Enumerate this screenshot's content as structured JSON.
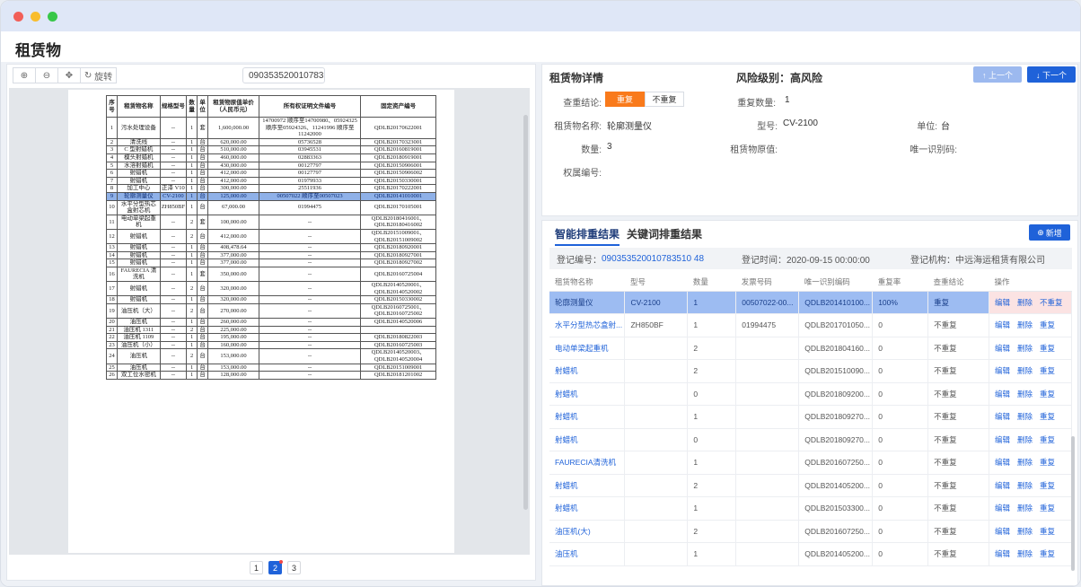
{
  "page": {
    "title": "租赁物"
  },
  "viewer": {
    "toolbar": {
      "zoom_in": "⊕",
      "zoom_out": "⊖",
      "move": "✥",
      "rotate": "旋转"
    },
    "doc_select": "090353520010783",
    "headers": [
      "序号",
      "租赁物名称",
      "规格型号",
      "数量",
      "单位",
      "租赁物原值单价（人民币元）",
      "所有权证明文件编号",
      "固定资产编号"
    ],
    "rows": [
      [
        "1",
        "污水处理设备",
        "--",
        "1",
        "套",
        "1,600,000.00",
        "14700972 顺序至14700980、05924325 顺序至05924326、11241996 顺序至11242000",
        "QDLB20170622001"
      ],
      [
        "2",
        "清洗线",
        "--",
        "1",
        "台",
        "620,000.00",
        "05736528",
        "QDLB20170323001"
      ],
      [
        "3",
        "C 型射蜡机",
        "--",
        "1",
        "台",
        "510,000.00",
        "03945531",
        "QDLB20160819001"
      ],
      [
        "4",
        "模头射蜡机",
        "--",
        "1",
        "台",
        "460,000.00",
        "02883363",
        "QDLB20180919001"
      ],
      [
        "5",
        "水溶射蜡机",
        "--",
        "1",
        "台",
        "430,000.00",
        "00127797",
        "QDLB20150906001"
      ],
      [
        "6",
        "射蜡机",
        "--",
        "1",
        "台",
        "412,000.00",
        "00127797",
        "QDLB20150906002"
      ],
      [
        "7",
        "射蜡机",
        "--",
        "1",
        "台",
        "412,000.00",
        "01979933",
        "QDLB20150330001"
      ],
      [
        "8",
        "加工中心",
        "正泽 V10",
        "1",
        "台",
        "300,000.00",
        "25511936",
        "QDLB20170222001"
      ],
      [
        "9",
        "轮廓测量仪",
        "CV-2100",
        "1",
        "台",
        "125,000.00",
        "00507022 顺序至00507023",
        "QDLB20141010001"
      ],
      [
        "10",
        "水平分型热芯盒射芯机",
        "ZH850BF",
        "1",
        "台",
        "67,000.00",
        "01994475",
        "QDLB20170105001"
      ],
      [
        "11",
        "电动单梁起重机",
        "--",
        "2",
        "套",
        "100,000.00",
        "--",
        "QDLB20180416001、QDLB20180416002"
      ],
      [
        "12",
        "射蜡机",
        "--",
        "2",
        "台",
        "412,000.00",
        "--",
        "QDLB20151009001、QDLB20151009002"
      ],
      [
        "13",
        "射蜡机",
        "--",
        "1",
        "台",
        "408,478.64",
        "--",
        "QDLB20180920001"
      ],
      [
        "14",
        "射蜡机",
        "--",
        "1",
        "台",
        "377,000.00",
        "--",
        "QDLB20180927001"
      ],
      [
        "15",
        "射蜡机",
        "--",
        "1",
        "台",
        "377,000.00",
        "--",
        "QDLB20180927002"
      ],
      [
        "16",
        "FAURECIA 清洗机",
        "--",
        "1",
        "套",
        "350,000.00",
        "--",
        "QDLB20160725004"
      ],
      [
        "17",
        "射蜡机",
        "--",
        "2",
        "台",
        "320,000.00",
        "--",
        "QDLB20140520001、QDLB20140520002"
      ],
      [
        "18",
        "射蜡机",
        "--",
        "1",
        "台",
        "320,000.00",
        "--",
        "QDLB20150330002"
      ],
      [
        "19",
        "油压机（大）",
        "--",
        "2",
        "台",
        "270,000.00",
        "--",
        "QDLB20160725001、QDLB20160725002"
      ],
      [
        "20",
        "油压机",
        "--",
        "1",
        "台",
        "260,000.00",
        "--",
        "QDLB20140520006"
      ],
      [
        "21",
        "油压机 1311",
        "--",
        "2",
        "台",
        "225,000.00",
        "--",
        ""
      ],
      [
        "22",
        "油压机 1109",
        "--",
        "1",
        "台",
        "195,000.00",
        "--",
        "QDLB20180822003"
      ],
      [
        "23",
        "油压机（小）",
        "--",
        "1",
        "台",
        "160,000.00",
        "--",
        "QDLB20160725003"
      ],
      [
        "24",
        "油压机",
        "--",
        "2",
        "台",
        "153,000.00",
        "--",
        "QDLB20140520003、QDLB20140520004"
      ],
      [
        "25",
        "油压机",
        "--",
        "1",
        "台",
        "153,000.00",
        "--",
        "QDLB20151009001"
      ],
      [
        "26",
        "双工位水密机",
        "--",
        "1",
        "台",
        "128,000.00",
        "--",
        "QDLB20181201002"
      ]
    ],
    "selected_row": 8,
    "pages": [
      "1",
      "2",
      "3"
    ],
    "active_page": 1
  },
  "detail": {
    "title": "租赁物详情",
    "risk": "风险级别：高风险",
    "prev": "↑ 上一个",
    "next": "↓ 下一个",
    "check_label": "查重结论:",
    "check_on": "重复",
    "check_off": "不重复",
    "dup_count_label": "重复数量:",
    "dup_count": "1",
    "name_label": "租赁物名称:",
    "name": "轮廓测量仪",
    "model_label": "型号:",
    "model": "CV-2100",
    "unit_label": "单位:",
    "unit": "台",
    "qty_label": "数量:",
    "qty": "3",
    "orig_label": "租赁物原值:",
    "uid_label": "唯一识别码:",
    "right_label": "权属编号:"
  },
  "results": {
    "tab_smart": "智能排重结果",
    "tab_keyword": "关键词排重结果",
    "new_btn": "新增",
    "reg_no_label": "登记编号：",
    "reg_no": "090353520010783510 48",
    "reg_time": "登记时间：2020-09-15 00:00:00",
    "reg_org": "登记机构：中远海运租赁有限公司",
    "headers": [
      "租赁物名称",
      "型号",
      "数量",
      "发票号码",
      "唯一识别编码",
      "重复率",
      "查重结论",
      "操作"
    ],
    "rows": [
      [
        "轮廓测量仪",
        "CV-2100",
        "1",
        "00507022-00...",
        "QDLB201410100...",
        "100%",
        "重复",
        "不重复"
      ],
      [
        "水平分型热芯盒射...",
        "ZH850BF",
        "1",
        "01994475",
        "QDLB201701050...",
        "0",
        "不重复",
        "重复"
      ],
      [
        "电动单梁起重机",
        "",
        "2",
        "",
        "QDLB201804160...",
        "0",
        "不重复",
        "重复"
      ],
      [
        "射蜡机",
        "",
        "2",
        "",
        "QDLB201510090...",
        "0",
        "不重复",
        "重复"
      ],
      [
        "射蜡机",
        "",
        "0",
        "",
        "QDLB201809200...",
        "0",
        "不重复",
        "重复"
      ],
      [
        "射蜡机",
        "",
        "1",
        "",
        "QDLB201809270...",
        "0",
        "不重复",
        "重复"
      ],
      [
        "射蜡机",
        "",
        "0",
        "",
        "QDLB201809270...",
        "0",
        "不重复",
        "重复"
      ],
      [
        "FAURECIA清洗机",
        "",
        "1",
        "",
        "QDLB201607250...",
        "0",
        "不重复",
        "重复"
      ],
      [
        "射蜡机",
        "",
        "2",
        "",
        "QDLB201405200...",
        "0",
        "不重复",
        "重复"
      ],
      [
        "射蜡机",
        "",
        "1",
        "",
        "QDLB201503300...",
        "0",
        "不重复",
        "重复"
      ],
      [
        "油压机(大)",
        "",
        "2",
        "",
        "QDLB201607250...",
        "0",
        "不重复",
        "重复"
      ],
      [
        "油压机",
        "",
        "1",
        "",
        "QDLB201405200...",
        "0",
        "不重复",
        "重复"
      ]
    ],
    "edit": "编辑",
    "delete": "删除",
    "selected_row": 0
  },
  "colors": {
    "primary": "#1f62d9",
    "orange": "#f97a1b",
    "selected": "#9dbcf2"
  }
}
